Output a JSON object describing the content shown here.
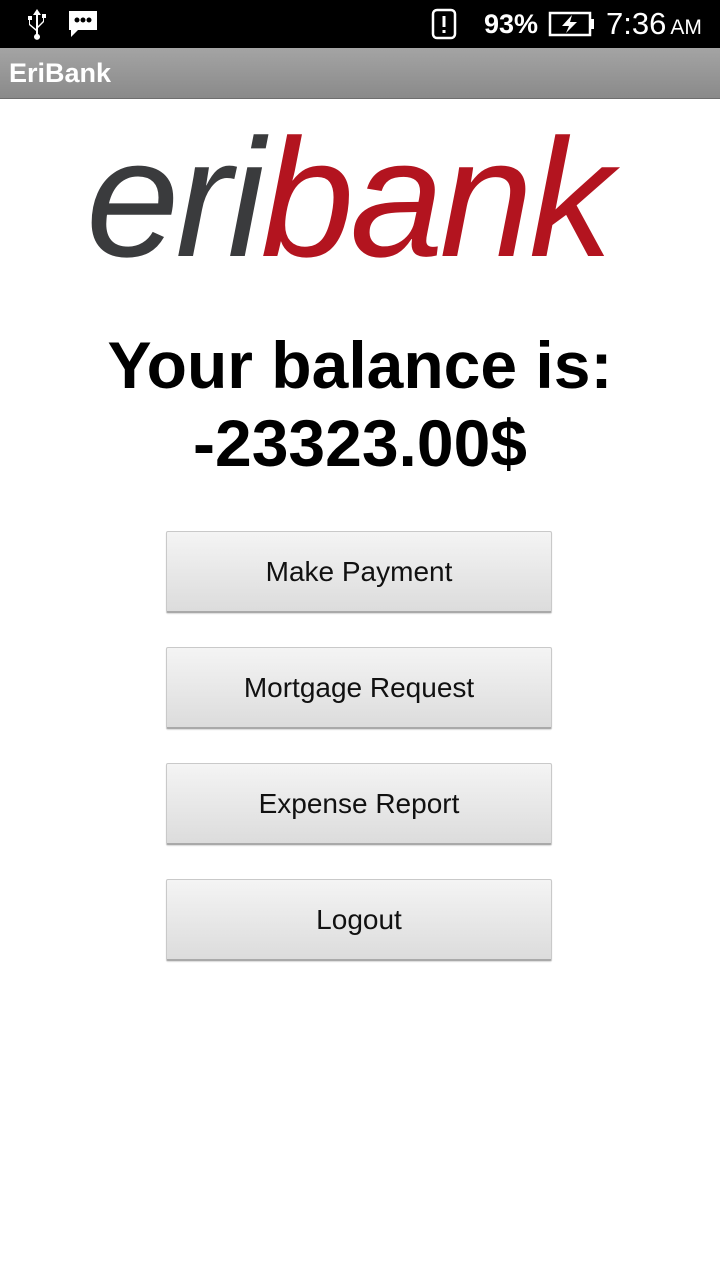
{
  "status_bar": {
    "battery_percent": "93%",
    "time": "7:36",
    "am_pm": "AM",
    "icons": [
      "usb-icon",
      "message-icon",
      "alert-icon",
      "battery-charging-icon"
    ]
  },
  "app_bar": {
    "title": "EriBank"
  },
  "logo": {
    "part1": "eri",
    "part2": "bank",
    "colors": {
      "part1": "#3a3b3d",
      "part2": "#b3141f"
    }
  },
  "balance": {
    "label": "Your balance is:",
    "amount": "-23323.00$"
  },
  "actions": {
    "make_payment": "Make Payment",
    "mortgage_request": "Mortgage Request",
    "expense_report": "Expense Report",
    "logout": "Logout"
  }
}
